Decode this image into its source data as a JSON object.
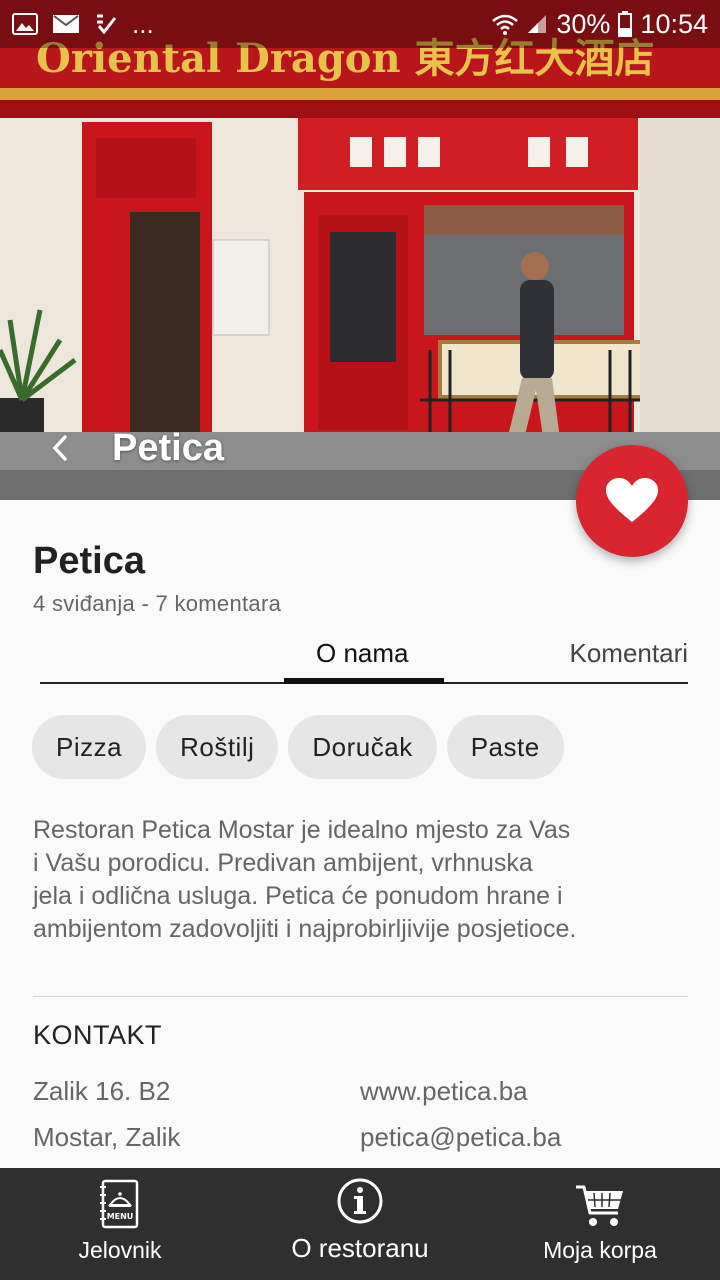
{
  "status_bar": {
    "battery": "30%",
    "time": "10:54",
    "more": "..."
  },
  "hero": {
    "title": "Petica",
    "sign_text": "Oriental Dragon 東方红大酒店"
  },
  "restaurant": {
    "name": "Petica",
    "stats": "4 sviđanja - 7 komentara"
  },
  "tabs": [
    {
      "label": "O nama",
      "active": true
    },
    {
      "label": "Komentari",
      "active": false
    }
  ],
  "chips": [
    "Pizza",
    "Roštilj",
    "Doručak",
    "Paste"
  ],
  "description": "Restoran Petica Mostar je idealno mjesto za Vas\ni Vašu porodicu. Predivan ambijent, vrhnuska\njela i odlična usluga. Petica će ponudom hrane i\nambijentom zadovoljiti i najprobirljivije posjetioce.",
  "contact": {
    "title": "KONTAKT",
    "address_line1": "Zalik 16. B2",
    "address_line2": "Mostar, Zalik",
    "website": "www.petica.ba",
    "email": "petica@petica.ba"
  },
  "bottom_nav": [
    {
      "label": "Jelovnik",
      "icon": "menu-book-icon"
    },
    {
      "label": "O restoranu",
      "icon": "info-icon"
    },
    {
      "label": "Moja korpa",
      "icon": "cart-icon"
    }
  ],
  "colors": {
    "accent": "#d7262f",
    "nav_bg": "#2f2f2f",
    "chip_bg": "#e6e6e6"
  }
}
